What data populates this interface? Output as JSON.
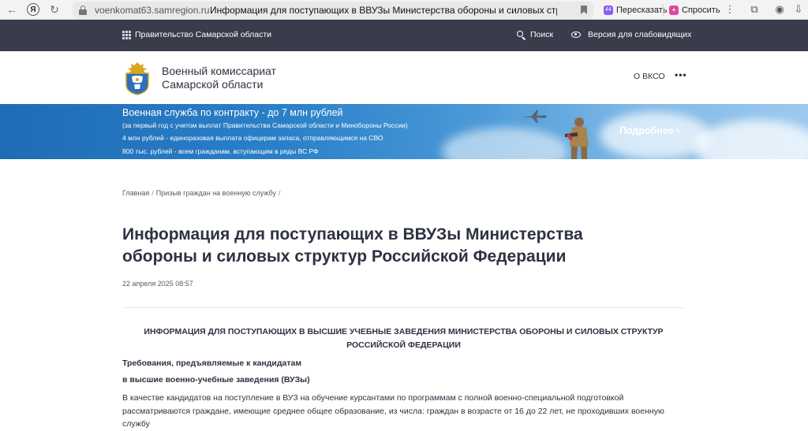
{
  "browser": {
    "domain": "voenkomat63.samregion.ru",
    "tab_title": "Информация для поступающих в ВВУЗы Министерства обороны и силовых стру...",
    "ext_retell_label": "Пересказать",
    "ext_retell_badge": "44",
    "ext_ask_label": "Спросить"
  },
  "topbar": {
    "gov_label": "Правительство Самарской области",
    "search_label": "Поиск",
    "accessibility_label": "Версия для слабовидящих"
  },
  "header": {
    "org_line1": "Военный комиссариат",
    "org_line2": "Самарской области",
    "about_label": "О ВКСО",
    "more_label": "•••"
  },
  "banner": {
    "title": "Военная служба по контракту - до 7 млн рублей",
    "line1": "(за первый год с учетом выплат Правительства Самарской области и Минобороны России)",
    "line2": "4 млн рублей - единоразовая выплата офицерам запаса, отправляющимся на СВО",
    "line3": "800 тыс. рублей - всем гражданам, вступающим в ряды ВС РФ",
    "more_label": "Подробнее ›"
  },
  "breadcrumb": {
    "home": "Главная",
    "section": "Призыв граждан на военную службу"
  },
  "article": {
    "title": "Информация для поступающих в ВВУЗы Министерства обороны и силовых структур Российской Федерации",
    "date": "22 апреля 2025 08:57",
    "section_heading": "ИНФОРМАЦИЯ ДЛЯ ПОСТУПАЮЩИХ В ВЫСШИЕ УЧЕБНЫЕ ЗАВЕДЕНИЯ МИНИСТЕРСТВА ОБОРОНЫ И СИЛОВЫХ СТРУКТУР РОССИЙСКОЙ ФЕДЕРАЦИИ",
    "req_heading_1": "Требования, предъявляемые к кандидатам",
    "req_heading_2": "в высшие военно-учебные заведения (ВУЗы)",
    "body": "В качестве кандидатов на поступление в ВУЗ на обучение курсантами по программам с полной военно-специальной подготовкой рассматриваются граждане, имеющие среднее общее образование, из числа: граждан в возрасте от 16 до 22 лет, не проходивших военную службу"
  },
  "colors": {
    "topbar_bg": "#383c4b",
    "title_text": "#2d3240",
    "banner_blue": "#2a80c8"
  }
}
